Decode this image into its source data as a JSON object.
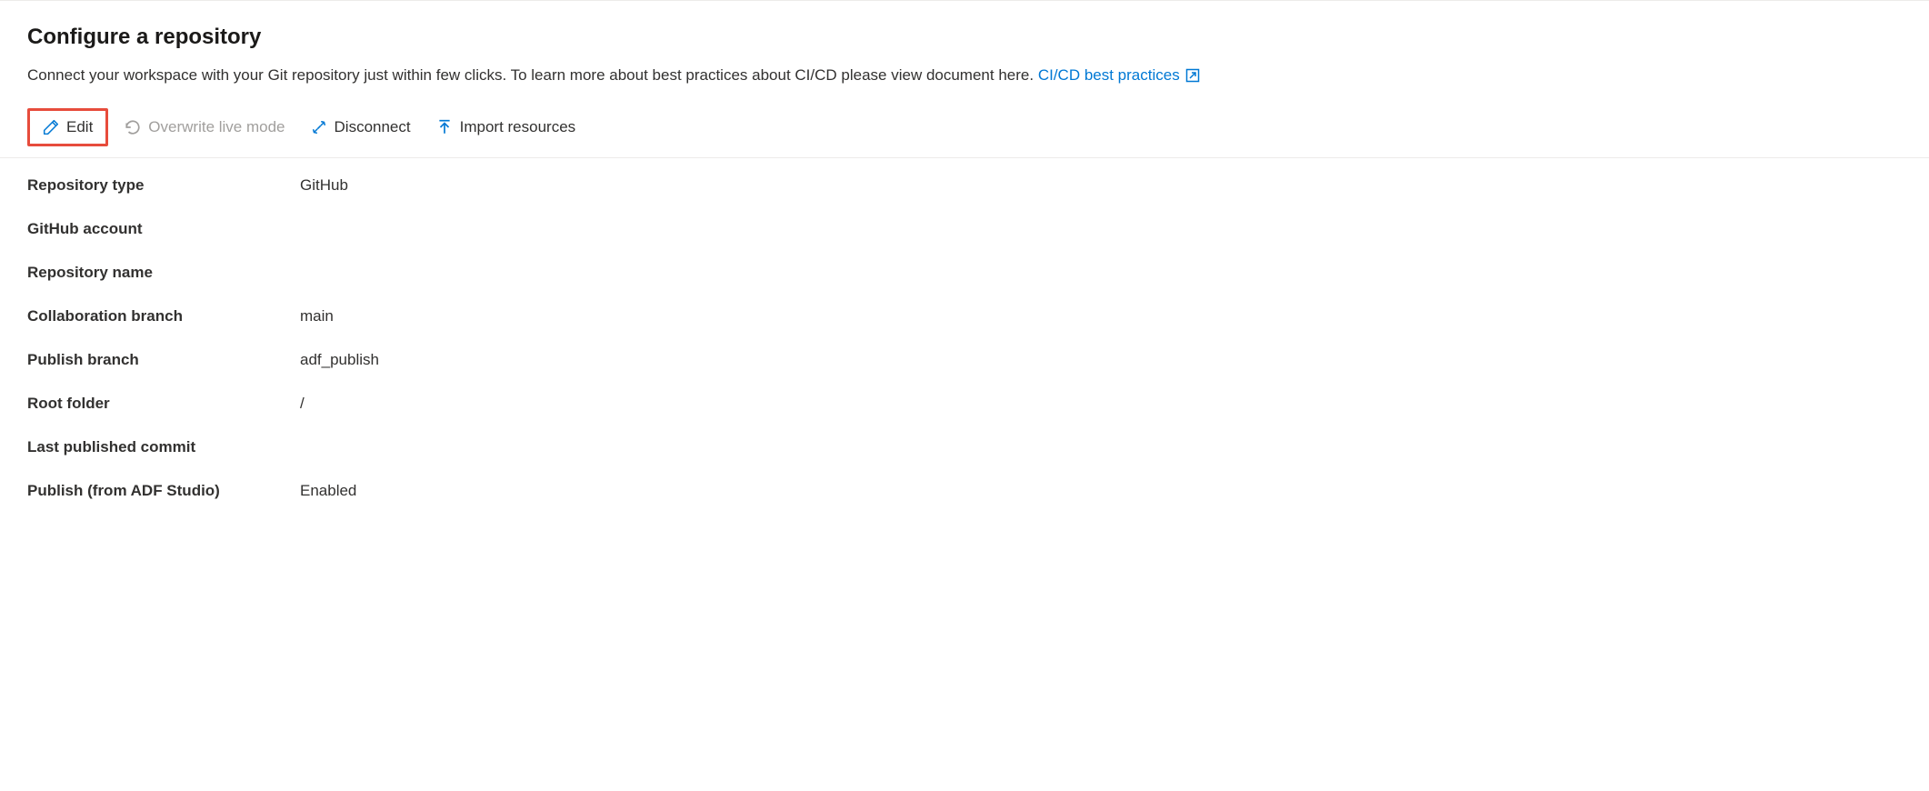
{
  "header": {
    "title": "Configure a repository",
    "description": "Connect your workspace with your Git repository just within few clicks. To learn more about best practices about CI/CD please view document here.",
    "link_text": "CI/CD best practices"
  },
  "toolbar": {
    "edit": "Edit",
    "overwrite": "Overwrite live mode",
    "disconnect": "Disconnect",
    "import": "Import resources"
  },
  "details": {
    "fields": [
      {
        "label": "Repository type",
        "value": "GitHub"
      },
      {
        "label": "GitHub account",
        "value": ""
      },
      {
        "label": "Repository name",
        "value": ""
      },
      {
        "label": "Collaboration branch",
        "value": "main"
      },
      {
        "label": "Publish branch",
        "value": "adf_publish"
      },
      {
        "label": "Root folder",
        "value": "/"
      },
      {
        "label": "Last published commit",
        "value": ""
      },
      {
        "label": "Publish (from ADF Studio)",
        "value": "Enabled"
      }
    ]
  }
}
